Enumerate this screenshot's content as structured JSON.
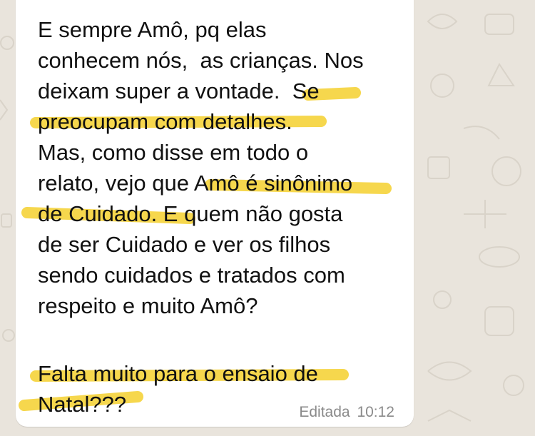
{
  "message": {
    "lines": [
      "E sempre Amô, pq elas",
      "conhecem nós,  as crianças. Nos",
      "deixam super a vontade.  Se",
      "preocupam com detalhes.",
      "Mas, como disse em todo o",
      "relato, vejo que Amô é sinônimo",
      "de Cuidado. E quem não gosta",
      "de ser Cuidado e ver os filhos",
      "sendo cuidados e tratados com",
      "respeito e muito Amô?",
      "",
      "Falta muito para o ensaio de",
      "Natal???"
    ],
    "edited_label": "Editada",
    "time": "10:12"
  },
  "colors": {
    "highlight": "#f5d33a",
    "bubble": "#ffffff",
    "wallpaper": "#e9e4dc",
    "text": "#111111",
    "meta": "#8a8a8a"
  }
}
